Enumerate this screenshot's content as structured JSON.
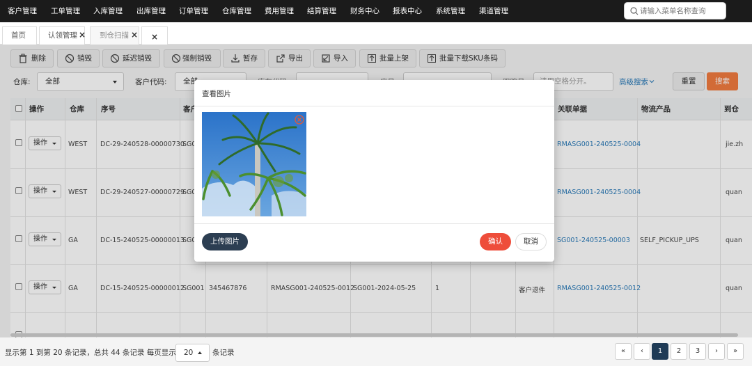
{
  "top_nav": {
    "items": [
      "客户管理",
      "工单管理",
      "入库管理",
      "出库管理",
      "订单管理",
      "仓库管理",
      "费用管理",
      "结算管理",
      "财务中心",
      "报表中心",
      "系统管理",
      "渠道管理"
    ],
    "search_placeholder": "请输入菜单名称查询"
  },
  "tabs": [
    {
      "label": "首页"
    },
    {
      "label": "认领管理"
    },
    {
      "label": "到仓扫描"
    }
  ],
  "toolbar": {
    "buttons": [
      "删除",
      "销毁",
      "延迟销毁",
      "强制销毁",
      "暂存",
      "导出",
      "导入",
      "批量上架",
      "批量下载SKU条码"
    ]
  },
  "filters": {
    "warehouse_label": "仓库:",
    "warehouse_value": "全部",
    "customer_code_label": "客户代码:",
    "customer_code_value": "全部",
    "tracking_label": "库存代码",
    "serial_label": "序号",
    "order_label": "跟踪号",
    "order_placeholder": "请用空格分开。",
    "advanced": "高级搜索",
    "reset": "重置",
    "search": "搜索"
  },
  "table": {
    "headers": {
      "op": "操作",
      "warehouse": "仓库",
      "serial": "序号",
      "customer": "客户",
      "related": "关联单据",
      "logistics": "物流产品",
      "arrival": "到仓"
    },
    "op_label": "操作",
    "rows": [
      {
        "warehouse": "WEST",
        "serial": "DC-29-240528-00000730",
        "customer": "SG0",
        "c1": "",
        "c2": "",
        "c3": "",
        "c4": "",
        "c5": "",
        "related": "RMASG001-240525-0004",
        "logistics": "",
        "arrival": "jie.zh"
      },
      {
        "warehouse": "WEST",
        "serial": "DC-29-240527-00000729",
        "customer": "SG0",
        "c1": "",
        "c2": "",
        "c3": "",
        "c4": "",
        "c5": "",
        "related": "RMASG001-240525-0004",
        "logistics": "",
        "arrival": "quan"
      },
      {
        "warehouse": "GA",
        "serial": "DC-15-240525-00000013",
        "customer": "SG0",
        "c1": "",
        "c2": "",
        "c3": "",
        "c4": "",
        "c5": "",
        "related": "SG001-240525-00003",
        "logistics": "SELF_PICKUP_UPS",
        "arrival": "quan"
      },
      {
        "warehouse": "GA",
        "serial": "DC-15-240525-00000012",
        "customer": "SG001",
        "c1": "345467876",
        "c2": "RMASG001-240525-0012",
        "c3": "SG001-2024-05-25",
        "c4": "1",
        "c5": "客户退件",
        "related": "RMASG001-240525-0012",
        "logistics": "",
        "arrival": "quan"
      }
    ]
  },
  "footer": {
    "text1": "显示第 1 到第 20 条记录，总共 44 条记录 每页显示",
    "page_size": "20",
    "text2": "条记录",
    "pages": [
      "«",
      "‹",
      "1",
      "2",
      "3",
      "›",
      "»"
    ]
  },
  "modal": {
    "title": "查看图片",
    "upload": "上传图片",
    "confirm": "确认",
    "cancel": "取消"
  },
  "colors": {
    "accent": "#f27b40",
    "nav": "#1b1b1b",
    "link": "#2a7ab8",
    "confirm": "#ee4d3a",
    "upload": "#2c3e52"
  }
}
